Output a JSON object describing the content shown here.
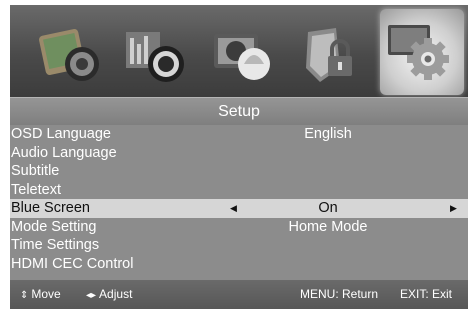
{
  "tabs": [
    {
      "icon": "picture-icon"
    },
    {
      "icon": "sound-icon"
    },
    {
      "icon": "channel-icon"
    },
    {
      "icon": "lock-icon"
    },
    {
      "icon": "setup-gear-icon",
      "selected": true
    }
  ],
  "title": "Setup",
  "menu": [
    {
      "label": "OSD Language",
      "value": "English"
    },
    {
      "label": "Audio Language",
      "value": ""
    },
    {
      "label": "Subtitle",
      "value": ""
    },
    {
      "label": "Teletext",
      "value": ""
    },
    {
      "label": "Blue Screen",
      "value": "On",
      "active": true
    },
    {
      "label": "Mode Setting",
      "value": "Home Mode"
    },
    {
      "label": "Time Settings",
      "value": ""
    },
    {
      "label": "HDMI CEC Control",
      "value": ""
    }
  ],
  "footer": {
    "move": "Move",
    "adjust": "Adjust",
    "menu_hint": "MENU: Return",
    "exit_hint": "EXIT: Exit"
  },
  "colors": {
    "panel": "#8c8c8c",
    "highlight": "#d6d6d6",
    "text": "#ffffff"
  }
}
